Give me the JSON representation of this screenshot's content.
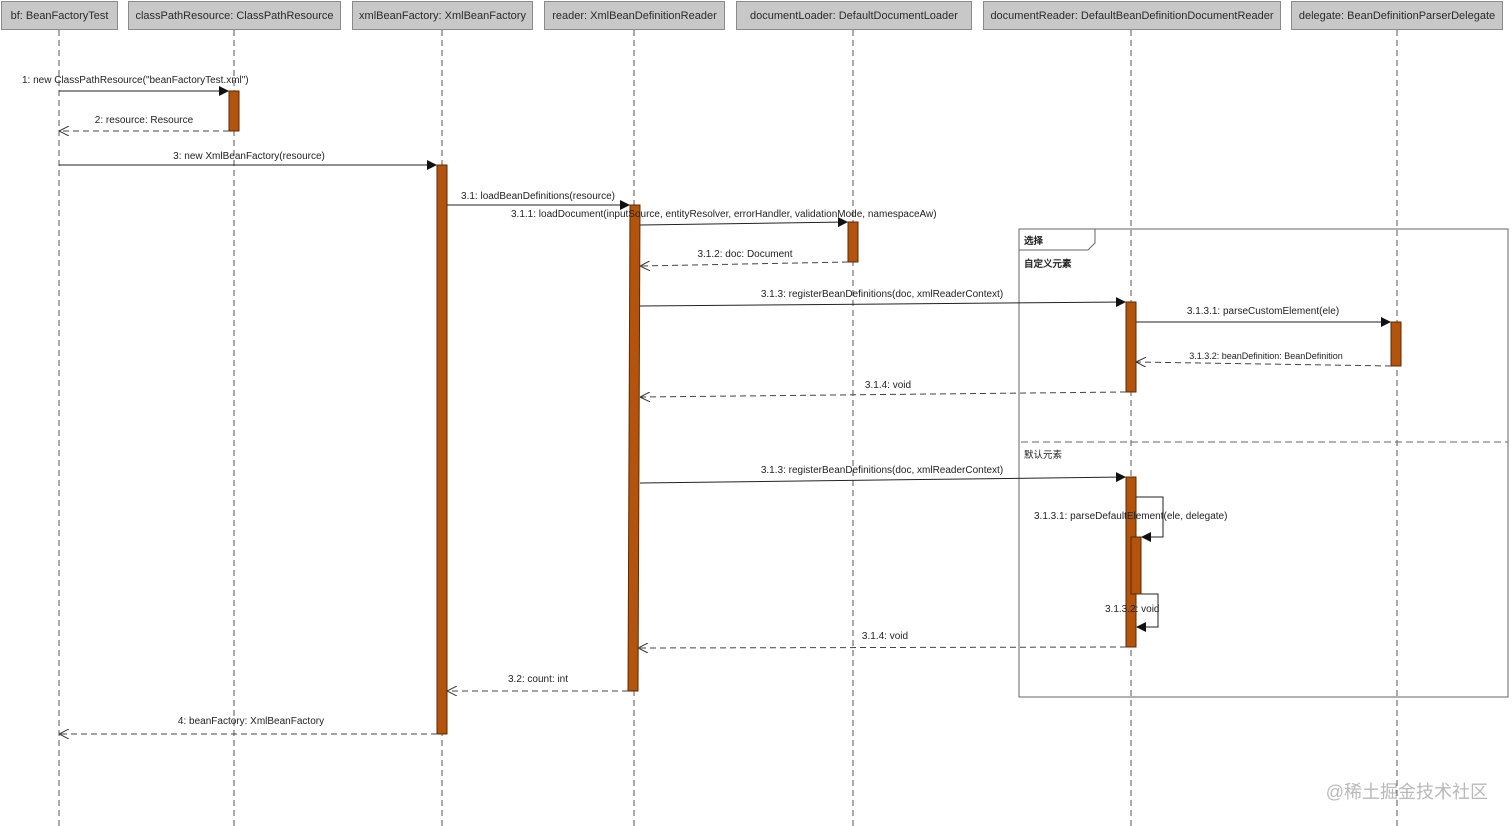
{
  "lifelines": [
    "bf: BeanFactoryTest",
    "classPathResource: ClassPathResource",
    "xmlBeanFactory: XmlBeanFactory",
    "reader: XmlBeanDefinitionReader",
    "documentLoader: DefaultDocumentLoader",
    "documentReader: DefaultBeanDefinitionDocumentReader",
    "delegate: BeanDefinitionParserDelegate"
  ],
  "messages": {
    "m1": "1: new ClassPathResource(\"beanFactoryTest.xml\")",
    "m2": "2: resource: Resource",
    "m3": "3: new XmlBeanFactory(resource)",
    "m31": "3.1: loadBeanDefinitions(resource)",
    "m311": "3.1.1: loadDocument(inputSource, entityResolver, errorHandler, validationMode, namespaceAw)",
    "m312": "3.1.2: doc: Document",
    "m313a": "3.1.3: registerBeanDefinitions(doc, xmlReaderContext)",
    "m3131a": "3.1.3.1: parseCustomElement(ele)",
    "m3132a": "3.1.3.2: beanDefinition: BeanDefinition",
    "m314a": "3.1.4: void",
    "m313b": "3.1.3: registerBeanDefinitions(doc, xmlReaderContext)",
    "m3131b": "3.1.3.1: parseDefaultElement(ele, delegate)",
    "m3132b": "3.1.3.2: void",
    "m314b": "3.1.4: void",
    "m32": "3.2: count: int",
    "m4": "4: beanFactory: XmlBeanFactory"
  },
  "frame": {
    "label": "选择",
    "cond1": "自定义元素",
    "cond2": "默认元素"
  },
  "colors": {
    "activation": "#b3530c",
    "header_bg": "#c8c8c8",
    "line": "#333333"
  },
  "watermark": "@稀土掘金技术社区"
}
